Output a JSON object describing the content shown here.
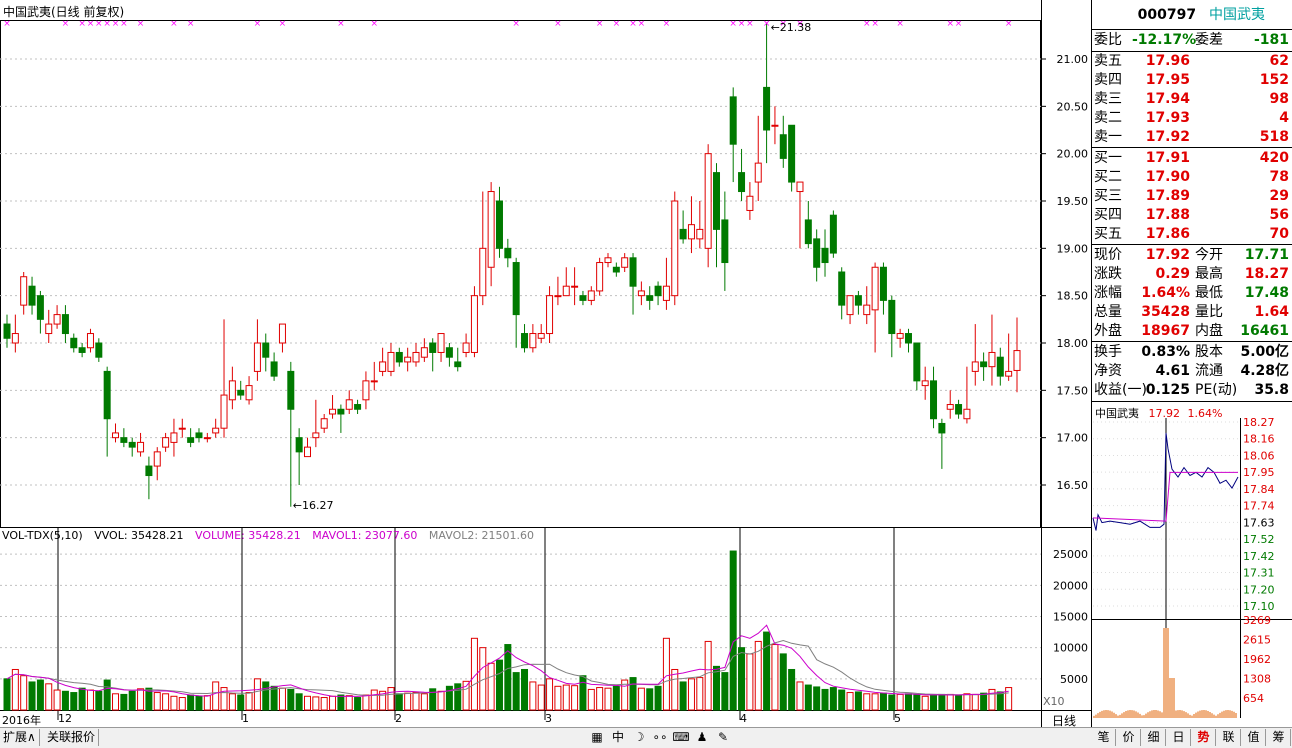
{
  "chart_title": "中国武夷(日线 前复权)",
  "vol_indicator": {
    "name": "VOL-TDX(5,10)",
    "vvol": "VVOL: 35428.21",
    "volume": "VOLUME: 35428.21",
    "mavol1": "MAVOL1: 23077.60",
    "mavol2": "MAVOL2: 21501.60"
  },
  "colors": {
    "up": "#e00000",
    "down": "#007a00",
    "ma1": "#cc00cc",
    "ma2": "#808080",
    "grid": "#c0c0c0",
    "axis": "#000000",
    "cross": "#ff00ff"
  },
  "price_axis": {
    "labels": [
      "21.00",
      "20.50",
      "20.00",
      "19.50",
      "19.00",
      "18.50",
      "18.00",
      "17.50",
      "17.00",
      "16.50"
    ]
  },
  "vol_axis": {
    "labels": [
      "25000",
      "20000",
      "15000",
      "10000",
      "5000"
    ],
    "unit": "X10"
  },
  "x_axis": {
    "labels": [
      "2016年",
      "12",
      "1",
      "2",
      "3",
      "4",
      "5"
    ],
    "period": "日线"
  },
  "annotations": {
    "high": "21.38",
    "low": "16.27"
  },
  "chart_data": {
    "type": "candlestick",
    "ylim": [
      16.27,
      21.38
    ],
    "vol_ylim": [
      0,
      26000
    ],
    "ohlc": [
      [
        18.2,
        18.05,
        18.3,
        17.95
      ],
      [
        18.0,
        18.1,
        18.3,
        17.9
      ],
      [
        18.4,
        18.7,
        18.75,
        18.3
      ],
      [
        18.6,
        18.4,
        18.7,
        18.3
      ],
      [
        18.5,
        18.25,
        18.55,
        18.1
      ],
      [
        18.1,
        18.2,
        18.35,
        18.0
      ],
      [
        18.2,
        18.3,
        18.4,
        18.15
      ],
      [
        18.3,
        18.1,
        18.4,
        18.0
      ],
      [
        18.05,
        17.95,
        18.1,
        17.9
      ],
      [
        17.95,
        17.9,
        18.0,
        17.85
      ],
      [
        17.95,
        18.1,
        18.15,
        17.9
      ],
      [
        18.0,
        17.85,
        18.05,
        17.8
      ],
      [
        17.7,
        17.2,
        17.75,
        16.8
      ],
      [
        17.0,
        17.05,
        17.15,
        16.95
      ],
      [
        17.0,
        16.95,
        17.1,
        16.9
      ],
      [
        16.95,
        16.9,
        17.0,
        16.8
      ],
      [
        16.85,
        16.95,
        17.05,
        16.8
      ],
      [
        16.7,
        16.6,
        16.8,
        16.35
      ],
      [
        16.7,
        16.85,
        16.9,
        16.55
      ],
      [
        16.9,
        17.0,
        17.05,
        16.85
      ],
      [
        16.95,
        17.05,
        17.2,
        16.8
      ],
      [
        17.1,
        17.1,
        17.2,
        17.0
      ],
      [
        17.0,
        16.95,
        17.1,
        16.9
      ],
      [
        17.05,
        17.0,
        17.1,
        16.95
      ],
      [
        17.0,
        17.0,
        17.05,
        16.95
      ],
      [
        17.05,
        17.1,
        17.2,
        17.0
      ],
      [
        17.1,
        17.45,
        18.25,
        17.0
      ],
      [
        17.4,
        17.6,
        17.75,
        17.3
      ],
      [
        17.5,
        17.45,
        17.6,
        17.4
      ],
      [
        17.4,
        17.55,
        17.65,
        17.35
      ],
      [
        17.7,
        18.0,
        18.25,
        17.6
      ],
      [
        18.0,
        17.85,
        18.1,
        17.7
      ],
      [
        17.8,
        17.65,
        17.9,
        17.6
      ],
      [
        18.0,
        18.2,
        18.2,
        17.9
      ],
      [
        17.7,
        17.3,
        17.8,
        16.27
      ],
      [
        17.0,
        16.85,
        17.1,
        16.5
      ],
      [
        16.8,
        16.9,
        17.0,
        16.8
      ],
      [
        17.0,
        17.05,
        17.4,
        16.9
      ],
      [
        17.1,
        17.2,
        17.25,
        17.05
      ],
      [
        17.25,
        17.3,
        17.45,
        17.2
      ],
      [
        17.3,
        17.25,
        17.35,
        17.05
      ],
      [
        17.3,
        17.4,
        17.5,
        17.25
      ],
      [
        17.35,
        17.3,
        17.4,
        17.25
      ],
      [
        17.4,
        17.6,
        17.7,
        17.3
      ],
      [
        17.6,
        17.6,
        17.8,
        17.5
      ],
      [
        17.7,
        17.8,
        17.95,
        17.65
      ],
      [
        17.7,
        17.9,
        18.0,
        17.65
      ],
      [
        17.9,
        17.8,
        17.95,
        17.75
      ],
      [
        17.8,
        17.85,
        17.95,
        17.7
      ],
      [
        17.8,
        17.9,
        18.0,
        17.75
      ],
      [
        17.85,
        17.95,
        18.05,
        17.8
      ],
      [
        18.0,
        17.9,
        18.05,
        17.7
      ],
      [
        17.9,
        18.1,
        18.1,
        17.8
      ],
      [
        17.95,
        17.85,
        18.0,
        17.75
      ],
      [
        17.8,
        17.75,
        17.95,
        17.7
      ],
      [
        17.9,
        18.0,
        18.1,
        17.85
      ],
      [
        17.9,
        18.5,
        18.6,
        17.85
      ],
      [
        18.5,
        19.0,
        19.6,
        18.4
      ],
      [
        18.8,
        19.6,
        19.7,
        18.6
      ],
      [
        19.5,
        19.0,
        19.65,
        18.9
      ],
      [
        19.0,
        18.9,
        19.1,
        18.8
      ],
      [
        18.85,
        18.3,
        18.9,
        17.95
      ],
      [
        18.1,
        17.95,
        18.2,
        17.9
      ],
      [
        17.95,
        18.1,
        18.2,
        17.9
      ],
      [
        18.05,
        18.1,
        18.2,
        18.0
      ],
      [
        18.1,
        18.5,
        18.6,
        18.0
      ],
      [
        18.5,
        18.5,
        18.7,
        18.4
      ],
      [
        18.5,
        18.6,
        18.8,
        18.5
      ],
      [
        18.6,
        18.6,
        18.8,
        18.4
      ],
      [
        18.5,
        18.45,
        18.55,
        18.4
      ],
      [
        18.45,
        18.55,
        18.6,
        18.4
      ],
      [
        18.55,
        18.85,
        18.9,
        18.5
      ],
      [
        18.85,
        18.9,
        18.95,
        18.8
      ],
      [
        18.8,
        18.75,
        18.85,
        18.7
      ],
      [
        18.8,
        18.9,
        18.95,
        18.75
      ],
      [
        18.9,
        18.6,
        18.95,
        18.3
      ],
      [
        18.5,
        18.55,
        18.65,
        18.4
      ],
      [
        18.5,
        18.45,
        18.6,
        18.35
      ],
      [
        18.6,
        18.5,
        18.65,
        18.4
      ],
      [
        18.45,
        18.6,
        18.9,
        18.35
      ],
      [
        18.5,
        19.5,
        19.6,
        18.4
      ],
      [
        19.2,
        19.1,
        19.4,
        19.05
      ],
      [
        19.1,
        19.25,
        19.55,
        18.95
      ],
      [
        19.1,
        19.2,
        19.5,
        19.0
      ],
      [
        19.0,
        20.0,
        20.1,
        18.8
      ],
      [
        19.8,
        19.2,
        19.9,
        18.8
      ],
      [
        19.3,
        18.85,
        19.6,
        18.55
      ],
      [
        20.6,
        20.1,
        20.7,
        19.7
      ],
      [
        19.8,
        19.6,
        20.05,
        19.5
      ],
      [
        19.4,
        19.55,
        19.7,
        19.3
      ],
      [
        19.7,
        19.9,
        20.4,
        19.5
      ],
      [
        20.7,
        20.25,
        21.38,
        19.9
      ],
      [
        20.3,
        20.3,
        20.5,
        20.1
      ],
      [
        20.2,
        19.95,
        20.4,
        19.85
      ],
      [
        20.3,
        19.7,
        20.3,
        19.6
      ],
      [
        19.6,
        19.7,
        19.6,
        19.0
      ],
      [
        19.3,
        19.05,
        19.5,
        19.0
      ],
      [
        19.1,
        18.8,
        19.2,
        18.65
      ],
      [
        19.0,
        18.85,
        19.2,
        18.7
      ],
      [
        19.35,
        18.95,
        19.4,
        18.9
      ],
      [
        18.75,
        18.4,
        18.8,
        18.25
      ],
      [
        18.3,
        18.5,
        18.5,
        18.2
      ],
      [
        18.5,
        18.4,
        18.55,
        18.3
      ],
      [
        18.3,
        18.4,
        18.6,
        18.2
      ],
      [
        18.35,
        18.8,
        18.85,
        17.9
      ],
      [
        18.8,
        18.45,
        18.85,
        18.3
      ],
      [
        18.45,
        18.1,
        18.5,
        17.85
      ],
      [
        18.05,
        18.1,
        18.15,
        17.95
      ],
      [
        18.1,
        18.0,
        18.15,
        17.9
      ],
      [
        18.0,
        17.6,
        18.0,
        17.5
      ],
      [
        17.55,
        17.6,
        17.75,
        17.4
      ],
      [
        17.6,
        17.2,
        17.75,
        17.1
      ],
      [
        17.15,
        17.05,
        17.2,
        16.67
      ],
      [
        17.3,
        17.35,
        17.5,
        17.2
      ],
      [
        17.35,
        17.25,
        17.4,
        17.2
      ],
      [
        17.2,
        17.3,
        17.75,
        17.15
      ],
      [
        17.7,
        17.8,
        18.2,
        17.55
      ],
      [
        17.8,
        17.75,
        17.9,
        17.6
      ],
      [
        17.75,
        17.9,
        18.3,
        17.55
      ],
      [
        17.85,
        17.65,
        17.95,
        17.55
      ],
      [
        17.65,
        17.7,
        18.1,
        17.6
      ],
      [
        17.71,
        17.92,
        18.27,
        17.48
      ]
    ],
    "volume": [
      5000,
      6500,
      5500,
      4500,
      4800,
      4200,
      3200,
      3000,
      2800,
      3500,
      3200,
      3000,
      4800,
      2600,
      2500,
      3000,
      3400,
      3500,
      2800,
      2600,
      2200,
      2000,
      2400,
      2200,
      2300,
      4500,
      3600,
      2600,
      2400,
      2800,
      5000,
      4500,
      3800,
      3500,
      3300,
      2600,
      2200,
      2100,
      2000,
      2200,
      2400,
      2300,
      2000,
      2400,
      3200,
      3000,
      3600,
      2600,
      2700,
      2800,
      2600,
      3400,
      3000,
      3800,
      4200,
      4600,
      11500,
      10000,
      7500,
      8000,
      10500,
      6000,
      6500,
      4500,
      4000,
      5000,
      3800,
      4000,
      3900,
      5500,
      3300,
      3600,
      3500,
      3800,
      4800,
      5200,
      3500,
      3400,
      3800,
      11500,
      6500,
      4500,
      5000,
      5200,
      11000,
      7000,
      6000,
      25500,
      10000,
      9000,
      11000,
      12500,
      10500,
      9000,
      6500,
      4500,
      4000,
      3700,
      3300,
      3600,
      3200,
      2800,
      2900,
      2600,
      2600,
      2700,
      2400,
      2500,
      2600,
      2400,
      2200,
      2400,
      2500,
      2500,
      2400,
      2600,
      2500,
      2700,
      3300,
      2900,
      3600
    ],
    "ma_ref_labels": [
      "MAVOL1",
      "MAVOL2"
    ]
  },
  "quote_panel": {
    "code": "000797",
    "name": "中国武夷",
    "weibi": {
      "label": "委比",
      "value": "-12.17%",
      "label2": "委差",
      "value2": "-181"
    },
    "sell": [
      {
        "label": "卖五",
        "price": "17.96",
        "qty": "62"
      },
      {
        "label": "卖四",
        "price": "17.95",
        "qty": "152"
      },
      {
        "label": "卖三",
        "price": "17.94",
        "qty": "98"
      },
      {
        "label": "卖二",
        "price": "17.93",
        "qty": "4"
      },
      {
        "label": "卖一",
        "price": "17.92",
        "qty": "518"
      }
    ],
    "buy": [
      {
        "label": "买一",
        "price": "17.91",
        "qty": "420"
      },
      {
        "label": "买二",
        "price": "17.90",
        "qty": "78"
      },
      {
        "label": "买三",
        "price": "17.89",
        "qty": "29"
      },
      {
        "label": "买四",
        "price": "17.88",
        "qty": "56"
      },
      {
        "label": "买五",
        "price": "17.86",
        "qty": "70"
      }
    ],
    "stats": [
      {
        "l1": "现价",
        "v1": "17.92",
        "c1": "red",
        "l2": "今开",
        "v2": "17.71",
        "c2": "green"
      },
      {
        "l1": "涨跌",
        "v1": "0.29",
        "c1": "red",
        "l2": "最高",
        "v2": "18.27",
        "c2": "red"
      },
      {
        "l1": "涨幅",
        "v1": "1.64%",
        "c1": "red",
        "l2": "最低",
        "v2": "17.48",
        "c2": "green"
      },
      {
        "l1": "总量",
        "v1": "35428",
        "c1": "red",
        "l2": "量比",
        "v2": "1.64",
        "c2": "red"
      },
      {
        "l1": "外盘",
        "v1": "18967",
        "c1": "red",
        "l2": "内盘",
        "v2": "16461",
        "c2": "green"
      }
    ],
    "fund": [
      {
        "l1": "换手",
        "v1": "0.83%",
        "l2": "股本",
        "v2": "5.00亿"
      },
      {
        "l1": "净资",
        "v1": "4.61",
        "l2": "流通",
        "v2": "4.28亿"
      },
      {
        "l1": "收益(一)",
        "v1": "0.125",
        "l2": "PE(动)",
        "v2": "35.8"
      }
    ]
  },
  "mini_chart": {
    "name": "中国武夷",
    "price": "17.92",
    "pct": "1.64%",
    "price_labels": [
      "18.27",
      "18.16",
      "18.06",
      "17.95",
      "17.84",
      "17.74",
      "17.63",
      "17.52",
      "17.42",
      "17.31",
      "17.20",
      "17.10"
    ],
    "vol_labels": [
      "3269",
      "2615",
      "1962",
      "1308",
      "654"
    ]
  },
  "bottom_tabs": {
    "left": [
      "扩展∧",
      "关联报价"
    ],
    "right": [
      "笔",
      "价",
      "细",
      "日",
      "势",
      "联",
      "值",
      "筹"
    ]
  },
  "toolbar_icons": [
    "grid-icon",
    "zh-icon",
    "moon-icon",
    "dots-icon",
    "keyboard-icon",
    "user-icon",
    "wrench-icon"
  ]
}
